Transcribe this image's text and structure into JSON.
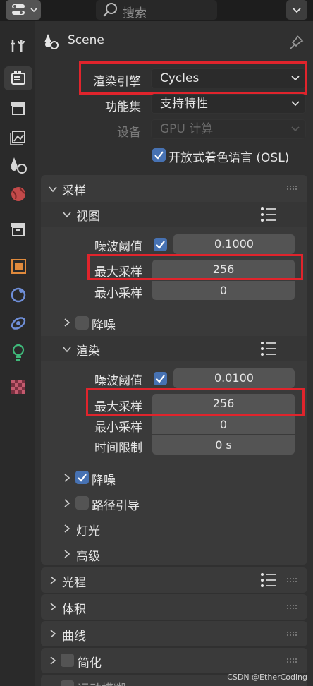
{
  "topbar": {
    "search_placeholder": "搜索"
  },
  "header": {
    "context_label": "Scene"
  },
  "render": {
    "engine_label": "渲染引擎",
    "engine_value": "Cycles",
    "feature_set_label": "功能集",
    "feature_set_value": "支持特性",
    "device_label": "设备",
    "device_value": "GPU 计算",
    "osl_label": "开放式着色语言 (OSL)"
  },
  "sampling": {
    "title": "采样",
    "viewport": {
      "title": "视图",
      "noise_threshold_label": "噪波阈值",
      "noise_threshold_value": "0.1000",
      "max_samples_label": "最大采样",
      "max_samples_value": "256",
      "min_samples_label": "最小采样",
      "min_samples_value": "0",
      "denoise_label": "降噪"
    },
    "render": {
      "title": "渲染",
      "noise_threshold_label": "噪波阈值",
      "noise_threshold_value": "0.0100",
      "max_samples_label": "最大采样",
      "max_samples_value": "256",
      "min_samples_label": "最小采样",
      "min_samples_value": "0",
      "time_limit_label": "时间限制",
      "time_limit_value": "0 s",
      "denoise_label": "降噪"
    },
    "path_guiding_label": "路径引导",
    "lights_label": "灯光",
    "advanced_label": "高级"
  },
  "panels": {
    "light_paths": "光程",
    "volumes": "体积",
    "curves": "曲线",
    "simplify": "简化",
    "motion_blur": "运动模糊"
  },
  "watermark": "CSDN @EtherCoding",
  "colors": {
    "accent_blue": "#4772b3",
    "highlight_red": "#e0242c"
  }
}
